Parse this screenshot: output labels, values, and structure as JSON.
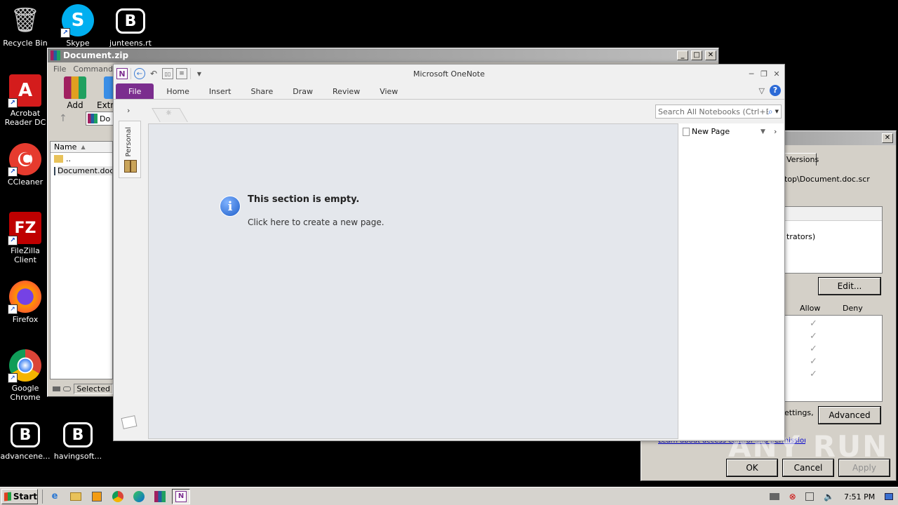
{
  "desktop": {
    "icons": [
      {
        "label": "Recycle Bin",
        "glyph": "🗑"
      },
      {
        "label": "Skype",
        "glyph": "S"
      },
      {
        "label": "junteens.rt",
        "glyph": "B"
      },
      {
        "label": "Acrobat Reader DC",
        "glyph": "A"
      },
      {
        "label": "CCleaner",
        "glyph": "C"
      },
      {
        "label": "FileZilla Client",
        "glyph": "FZ"
      },
      {
        "label": "Firefox",
        "glyph": "🦊"
      },
      {
        "label": "Google Chrome",
        "glyph": "◉"
      },
      {
        "label": "advancene...",
        "glyph": "B"
      },
      {
        "label": "havingsoft...",
        "glyph": "B"
      }
    ]
  },
  "winrar": {
    "title": "Document.zip",
    "menu": [
      "File",
      "Commands"
    ],
    "toolbar": {
      "add": "Add",
      "extract": "Extr"
    },
    "address": "Do",
    "column_name": "Name",
    "rows": [
      "..",
      "Document.doc"
    ],
    "status": "Selected"
  },
  "props": {
    "tab": "Versions",
    "path": "top\\Document.doc.scr",
    "group_item": "trators)",
    "edit": "Edit...",
    "allow": "Allow",
    "deny": "Deny",
    "checks": [
      "✓",
      "✓",
      "✓",
      "✓",
      "✓"
    ],
    "settings_text": "ettings,",
    "advanced": "Advanced",
    "learn_link": "Learn about access control and permissions",
    "ok": "OK",
    "cancel": "Cancel",
    "apply": "Apply"
  },
  "onenote": {
    "title": "Microsoft OneNote",
    "tabs": [
      "File",
      "Home",
      "Insert",
      "Share",
      "Draw",
      "Review",
      "View"
    ],
    "search_placeholder": "Search All Notebooks (Ctrl+E)",
    "notebook": "Personal",
    "empty_title": "This section is empty.",
    "empty_link": "Click here to create a new page.",
    "new_page": "New Page"
  },
  "taskbar": {
    "start": "Start",
    "clock": "7:51 PM"
  },
  "watermark": "ANY RUN"
}
